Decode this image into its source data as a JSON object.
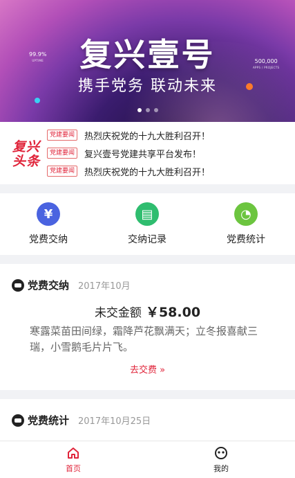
{
  "banner": {
    "title": "复兴壹号",
    "subtitle": "携手党务 联动未来",
    "stat_left_value": "99.9%",
    "stat_left_label": "UPTIME",
    "stat_right_value": "500,000",
    "stat_right_label": "APPS / PROJECTS",
    "slide_count": 3,
    "active_slide": 1
  },
  "headlines": {
    "logo_line1": "复兴",
    "logo_line2": "头条",
    "items": [
      {
        "tag": "党建要闻",
        "text": "热烈庆祝党的十九大胜利召开！"
      },
      {
        "tag": "党建要闻",
        "text": "复兴壹号党建共享平台发布！"
      },
      {
        "tag": "党建要闻",
        "text": "热烈庆祝党的十九大胜利召开！"
      }
    ]
  },
  "functions": [
    {
      "label": "党费交纳",
      "icon": "yen-icon",
      "color": "#4a63e0",
      "glyph": "¥"
    },
    {
      "label": "交纳记录",
      "icon": "document-icon",
      "color": "#2fbd6f",
      "glyph": "▤"
    },
    {
      "label": "党费统计",
      "icon": "pie-chart-icon",
      "color": "#6cc53f",
      "glyph": "◔"
    }
  ],
  "payment_card": {
    "title": "党费交纳",
    "date": "2017年10月",
    "due_label": "未交金额",
    "due_amount": "￥58.00",
    "poem": "寒露菜苗田间绿，霜降芦花飘满天；立冬报喜献三瑞，小雪鹅毛片片飞。",
    "action": "去交费 »"
  },
  "stats_card": {
    "title": "党费统计",
    "date": "2017年10月25日"
  },
  "bottom_nav": {
    "items": [
      {
        "label": "首页",
        "icon": "home-icon",
        "active": true
      },
      {
        "label": "我的",
        "icon": "profile-icon",
        "active": false
      }
    ],
    "active_color": "#e0243a"
  }
}
